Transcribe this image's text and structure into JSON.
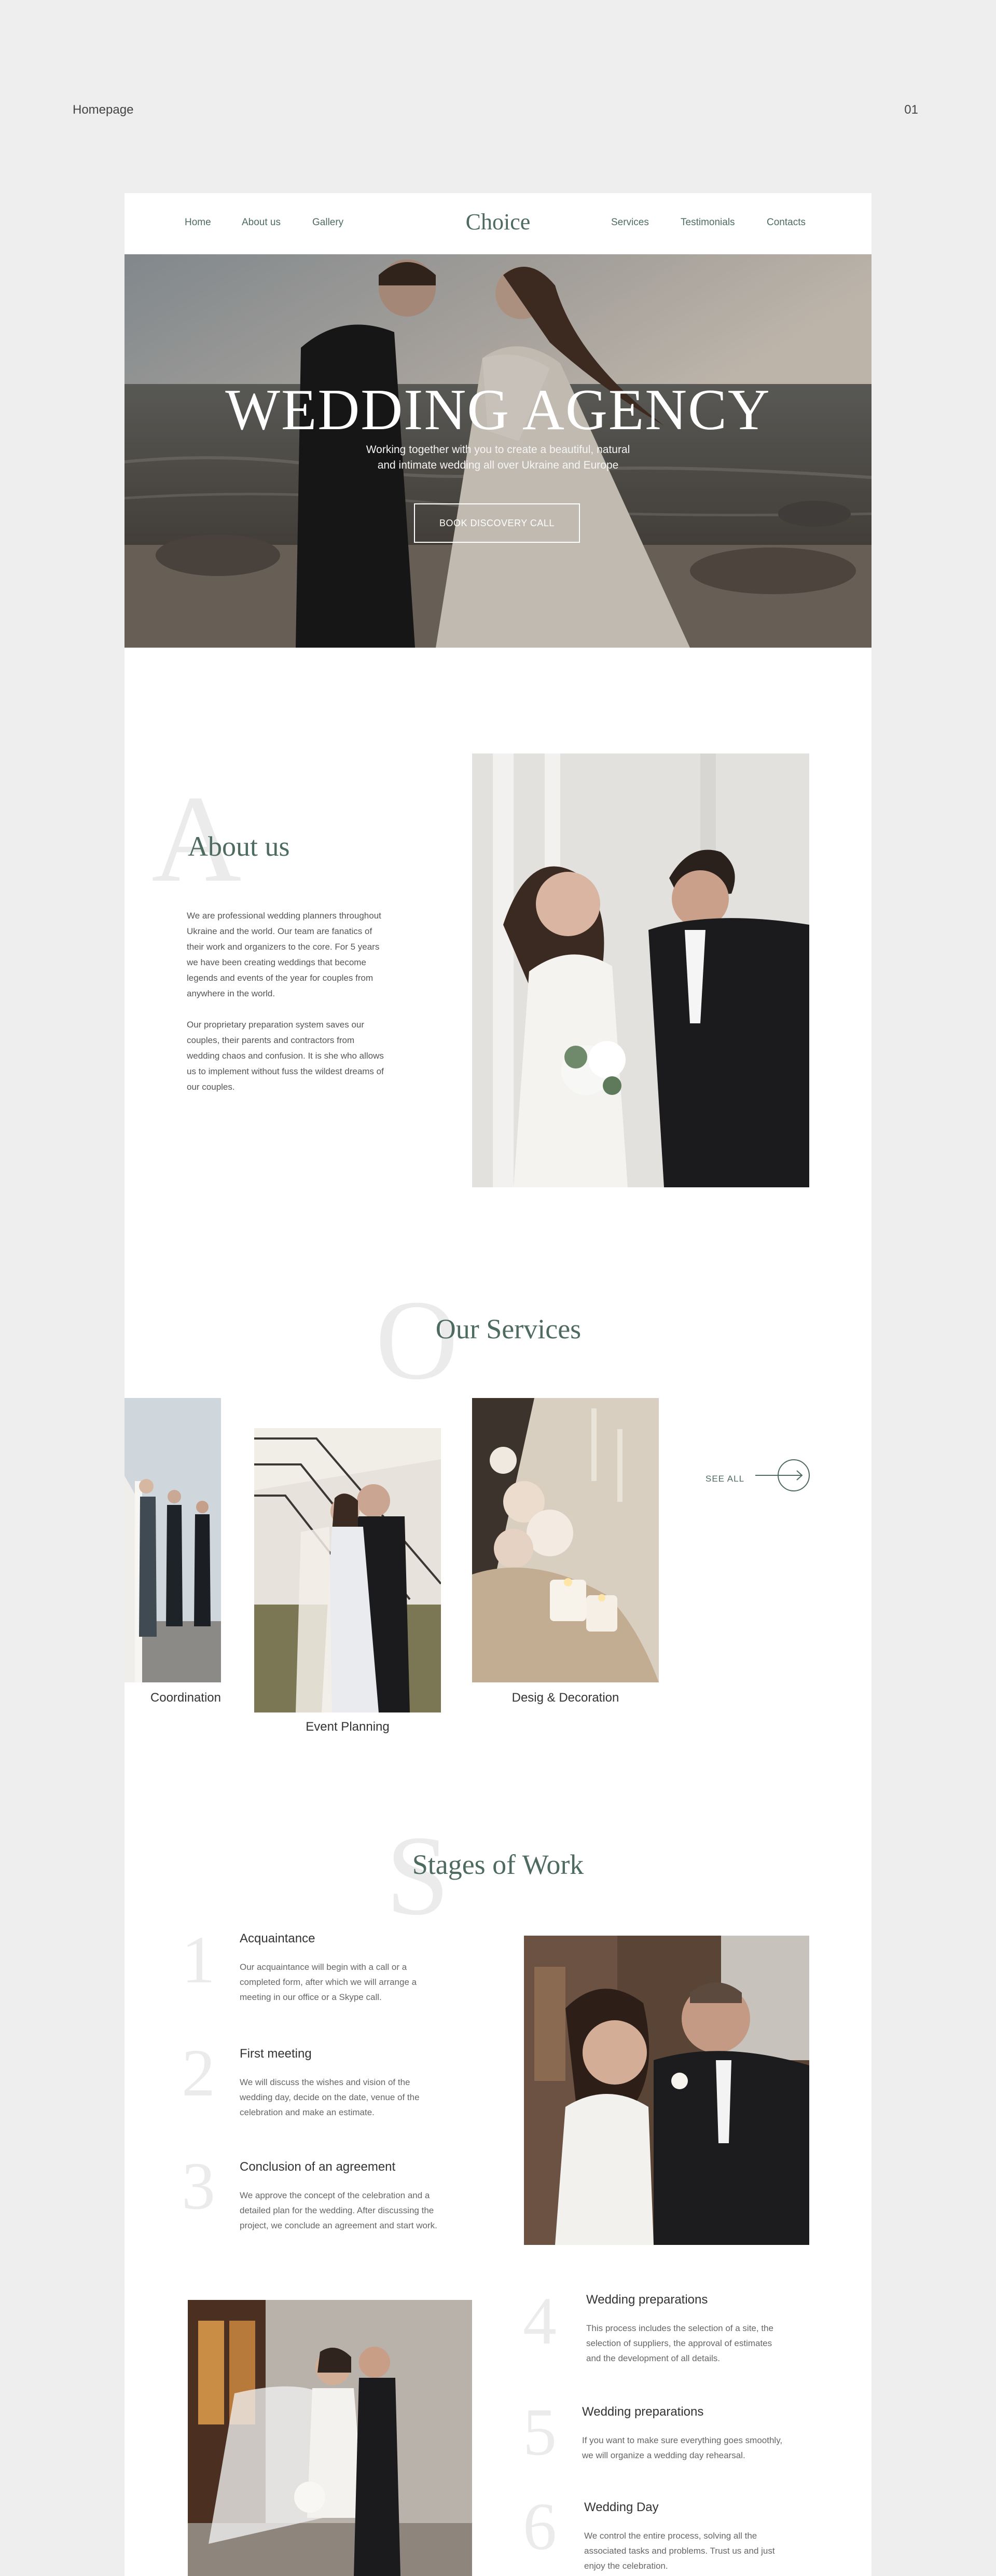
{
  "meta": {
    "page_name": "Homepage",
    "page_number": "01"
  },
  "nav": {
    "left": [
      "Home",
      "About us",
      "Gallery"
    ],
    "logo": "Choice",
    "right": [
      "Services",
      "Testimonials",
      "Contacts"
    ]
  },
  "hero": {
    "title": "WEDDING AGENCY",
    "subtitle_line1": "Working together with you to create a beautiful, natural",
    "subtitle_line2": "and intimate wedding all over Ukraine and Europe",
    "cta": "BOOK DISCOVERY CALL"
  },
  "about": {
    "letter": "A",
    "title": "About us",
    "p1": [
      "We are professional wedding planners throughout",
      "Ukraine and the world. Our team are fanatics of",
      "their work and organizers to the core. For 5 years",
      "we have been creating weddings that become",
      "legends and events of the year for couples from",
      "anywhere in the world."
    ],
    "p2": [
      "Our proprietary preparation system saves our",
      "couples, their parents and contractors from",
      "wedding chaos and confusion. It is she who allows",
      "us to implement without fuss the wildest dreams of",
      "our couples."
    ]
  },
  "services": {
    "letter": "O",
    "title": "Our Services",
    "items": [
      "Coordination",
      "Event Planning",
      "Desig & Decoration"
    ],
    "see_all": "SEE ALL"
  },
  "stages": {
    "letter": "S",
    "title": "Stages of Work",
    "items": [
      {
        "num": "1",
        "title": "Acquaintance",
        "text": [
          "Our acquaintance will begin with a call or a",
          "completed form, after which we will arrange a",
          "meeting in our office or a Skype call."
        ]
      },
      {
        "num": "2",
        "title": "First meeting",
        "text": [
          "We will discuss the wishes and vision of the",
          "wedding day, decide on the date, venue of the",
          "celebration and make an estimate."
        ]
      },
      {
        "num": "3",
        "title": "Conclusion of an agreement",
        "text": [
          "We approve the concept of the celebration and a",
          "detailed plan for the wedding. After discussing the",
          "project, we conclude an agreement and start work."
        ]
      },
      {
        "num": "4",
        "title": "Wedding preparations",
        "text": [
          "This process includes the selection of a site, the",
          "selection of suppliers, the approval of estimates",
          "and the development of all details."
        ]
      },
      {
        "num": "5",
        "title": "Wedding preparations",
        "text": [
          "If you want to make sure everything goes smoothly,",
          "we will organize a wedding day rehearsal."
        ]
      },
      {
        "num": "6",
        "title": "Wedding Day",
        "text": [
          "We control the entire process, solving all the",
          "associated tasks and problems. Trust us and just",
          "enjoy the celebration."
        ]
      }
    ]
  },
  "colors": {
    "accent": "#4d6b5e",
    "page_bg": "#eeeeee",
    "card_bg": "#ffffff",
    "ghost_numeral": "#ebebeb"
  }
}
